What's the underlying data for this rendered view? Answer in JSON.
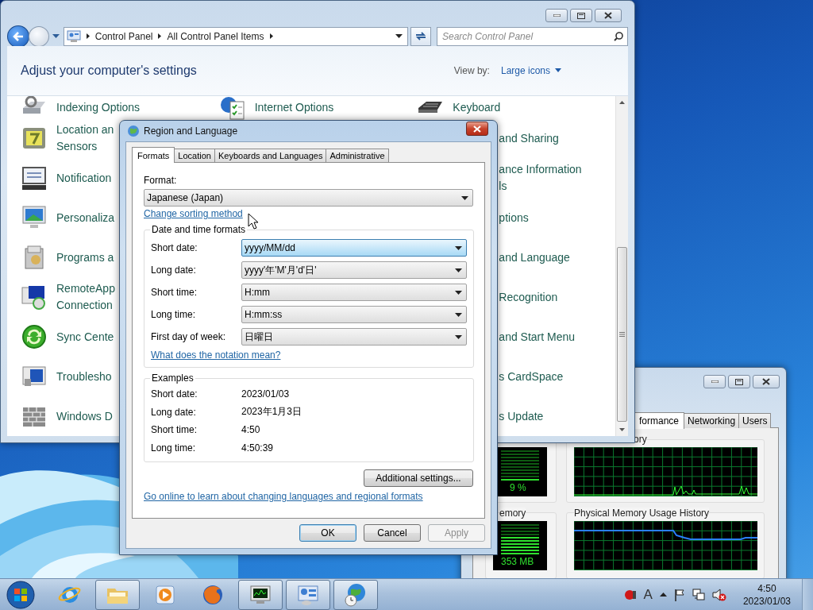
{
  "control_panel": {
    "breadcrumb": [
      "Control Panel",
      "All Control Panel Items"
    ],
    "search": {
      "placeholder": "Search Control Panel"
    },
    "heading": "Adjust your computer's settings",
    "view_by": {
      "label": "View by:",
      "value": "Large icons"
    },
    "column_1": [
      {
        "lines": [
          "Indexing Options"
        ]
      },
      {
        "lines": [
          "Location an",
          "Sensors"
        ]
      },
      {
        "lines": [
          "Notification"
        ]
      },
      {
        "lines": [
          "Personaliza"
        ]
      },
      {
        "lines": [
          "Programs a"
        ]
      },
      {
        "lines": [
          "RemoteApp",
          "Connection"
        ]
      },
      {
        "lines": [
          "Sync Cente"
        ]
      },
      {
        "lines": [
          "Troublesho"
        ]
      },
      {
        "lines": [
          "Windows D"
        ]
      }
    ],
    "column_2": [
      {
        "lines": [
          "Internet Options"
        ]
      }
    ],
    "column_3": [
      {
        "lines": [
          "Keyboard"
        ]
      },
      {
        "lines": [
          "and Sharing"
        ]
      },
      {
        "lines": [
          "ance Information",
          "ls"
        ]
      },
      {
        "lines": [
          "ptions"
        ]
      },
      {
        "lines": [
          "and Language"
        ]
      },
      {
        "lines": [
          "Recognition"
        ]
      },
      {
        "lines": [
          "and Start Menu"
        ]
      },
      {
        "lines": [
          "s CardSpace"
        ]
      },
      {
        "lines": [
          "s Update"
        ]
      }
    ]
  },
  "dialog": {
    "title": "Region and Language",
    "tabs": [
      {
        "label": "Formats",
        "selected": true
      },
      {
        "label": "Location",
        "selected": false
      },
      {
        "label": "Keyboards and Languages",
        "selected": false
      },
      {
        "label": "Administrative",
        "selected": false
      }
    ],
    "format": {
      "label": "Format:",
      "value": "Japanese (Japan)"
    },
    "sorting_link": "Change sorting method",
    "date_time_formats": {
      "title": "Date and time formats",
      "rows": [
        {
          "label": "Short date:",
          "value": "yyyy/MM/dd",
          "focused": true
        },
        {
          "label": "Long date:",
          "value": "yyyy'年'M'月'd'日'",
          "focused": false
        },
        {
          "label": "Short time:",
          "value": "H:mm",
          "focused": false
        },
        {
          "label": "Long time:",
          "value": "H:mm:ss",
          "focused": false
        },
        {
          "label": "First day of week:",
          "value": "日曜日",
          "focused": false
        }
      ],
      "link": "What does the notation mean?"
    },
    "examples": {
      "title": "Examples",
      "rows": [
        {
          "label": "Short date:",
          "value": "2023/01/03"
        },
        {
          "label": "Long date:",
          "value": "2023年1月3日"
        },
        {
          "label": "Short time:",
          "value": "4:50"
        },
        {
          "label": "Long time:",
          "value": "4:50:39"
        }
      ]
    },
    "additional_button": "Additional settings...",
    "online_link": "Go online to learn about changing languages and regional formats",
    "buttons": [
      {
        "label": "OK",
        "default": true,
        "disabled": false
      },
      {
        "label": "Cancel",
        "default": false,
        "disabled": false
      },
      {
        "label": "Apply",
        "default": false,
        "disabled": true
      }
    ]
  },
  "task_manager": {
    "tabs": [
      {
        "label": "formance",
        "selected": true
      },
      {
        "label": "Networking",
        "selected": false
      },
      {
        "label": "Users",
        "selected": false
      }
    ],
    "cpu_history_label": "ory",
    "cpu_usage": "9 %",
    "memory_label": "emory",
    "memory_usage": "353 MB",
    "memory_history_label": "Physical Memory Usage History"
  },
  "taskbar": {
    "buttons": [
      {
        "open": false
      },
      {
        "open": true
      },
      {
        "open": false
      },
      {
        "open": false
      },
      {
        "open": true
      },
      {
        "open": true
      },
      {
        "open": true
      }
    ],
    "ime": "A",
    "time": "4:50",
    "date": "2023/01/03"
  }
}
